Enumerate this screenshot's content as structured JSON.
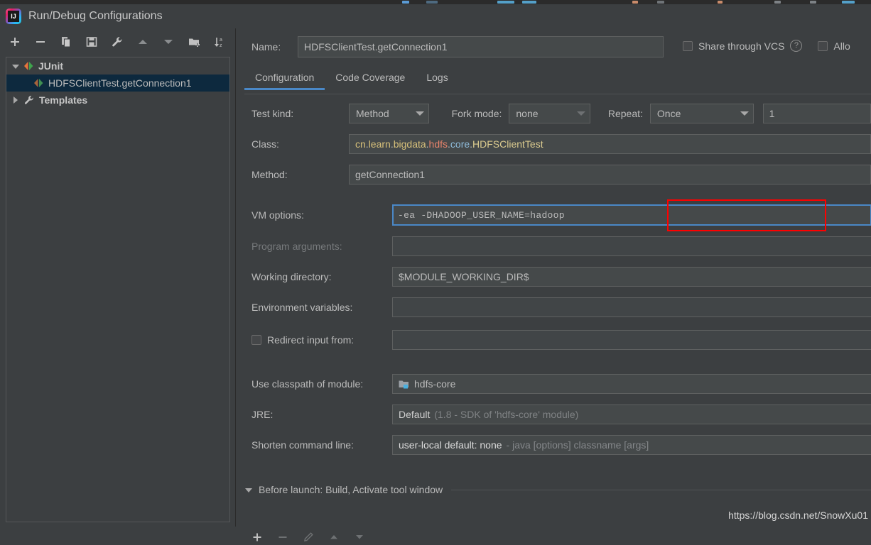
{
  "window": {
    "title": "Run/Debug Configurations",
    "logo_icon": "intellij-idea-logo"
  },
  "sidebar": {
    "toolbar": [
      {
        "name": "add",
        "icon": "plus-icon"
      },
      {
        "name": "remove",
        "icon": "minus-icon"
      },
      {
        "name": "copy",
        "icon": "copy-icon"
      },
      {
        "name": "save",
        "icon": "save-icon"
      },
      {
        "name": "edit-templates",
        "icon": "wrench-icon"
      },
      {
        "name": "move-up",
        "icon": "arrow-up-icon"
      },
      {
        "name": "move-down",
        "icon": "arrow-down-icon"
      },
      {
        "name": "new-folder",
        "icon": "folder-add-icon"
      },
      {
        "name": "sort-alphabetically",
        "icon": "sort-az-icon"
      }
    ],
    "tree": [
      {
        "label": "JUnit",
        "icon": "junit-icon",
        "expanded": true,
        "level": 1,
        "selected": false,
        "bold": true
      },
      {
        "label": "HDFSClientTest.getConnection1",
        "icon": "junit-icon",
        "level": 2,
        "selected": true,
        "bold": false
      },
      {
        "label": "Templates",
        "icon": "wrench-icon",
        "expanded": false,
        "level": 1,
        "selected": false,
        "bold": true
      }
    ]
  },
  "header": {
    "name_label": "Name:",
    "name_value": "HDFSClientTest.getConnection1",
    "share_vcs_label": "Share through VCS",
    "share_vcs_checked": false,
    "help_icon": "help-icon",
    "allow_parallel_label": "Allo",
    "allow_parallel_checked": false
  },
  "tabs": [
    {
      "label": "Configuration",
      "active": true
    },
    {
      "label": "Code Coverage",
      "active": false
    },
    {
      "label": "Logs",
      "active": false
    }
  ],
  "form": {
    "test_kind_label": "Test kind:",
    "test_kind_value": "Method",
    "fork_mode_label": "Fork mode:",
    "fork_mode_value": "none",
    "repeat_label": "Repeat:",
    "repeat_value": "Once",
    "repeat_count": "1",
    "class_label": "Class:",
    "class_tokens": [
      {
        "text": "cn",
        "color": "#d7c07a"
      },
      {
        "text": ".",
        "color": "#bbbbbb"
      },
      {
        "text": "learn",
        "color": "#d7c07a"
      },
      {
        "text": ".",
        "color": "#bbbbbb"
      },
      {
        "text": "bigdata",
        "color": "#d7c07a"
      },
      {
        "text": ".",
        "color": "#bbbbbb"
      },
      {
        "text": "hdfs",
        "color": "#e8836b"
      },
      {
        "text": ".",
        "color": "#bbbbbb"
      },
      {
        "text": "core",
        "color": "#8fbcdb"
      },
      {
        "text": ".",
        "color": "#bbbbbb"
      },
      {
        "text": "HDFSClientTest",
        "color": "#dbcb8f"
      }
    ],
    "class_value": "cn.learn.bigdata.hdfs.core.HDFSClientTest",
    "method_label": "Method:",
    "method_value": "getConnection1",
    "vm_options_label": "VM options:",
    "vm_options_prefix": "-ea",
    "vm_options_highlighted": "-DHADOOP_USER_NAME=hadoop",
    "vm_options_value": "-ea -DHADOOP_USER_NAME=hadoop",
    "program_arguments_label": "Program arguments:",
    "program_arguments_value": "",
    "working_directory_label": "Working directory:",
    "working_directory_value": "$MODULE_WORKING_DIR$",
    "environment_variables_label": "Environment variables:",
    "environment_variables_value": "",
    "redirect_input_label": "Redirect input from:",
    "redirect_input_checked": false,
    "redirect_input_value": "",
    "classpath_label": "Use classpath of module:",
    "classpath_value": "hdfs-core",
    "classpath_icon": "module-icon",
    "jre_label": "JRE:",
    "jre_value": "Default",
    "jre_detail": "(1.8 - SDK of 'hdfs-core' module)",
    "shorten_label": "Shorten command line:",
    "shorten_value": "user-local default: none",
    "shorten_detail": "- java [options] classname [args]"
  },
  "before_launch": {
    "title": "Before launch: Build, Activate tool window",
    "toolbar": [
      {
        "name": "add-task",
        "icon": "plus-icon",
        "enabled": true
      },
      {
        "name": "remove-task",
        "icon": "minus-icon",
        "enabled": false
      },
      {
        "name": "edit-task",
        "icon": "pencil-icon",
        "enabled": false
      },
      {
        "name": "move-task-up",
        "icon": "arrow-up-icon",
        "enabled": false
      },
      {
        "name": "move-task-down",
        "icon": "arrow-down-icon",
        "enabled": false
      }
    ]
  },
  "watermark": {
    "text": "https://blog.csdn.net/SnowXu01"
  },
  "colors": {
    "background": "#3c3f41",
    "field_background": "#45494a",
    "accent": "#4a88c7",
    "selection": "#0d293e",
    "annotation": "#ff0000",
    "text": "#bbbbbb",
    "text_dim": "#7f8284"
  }
}
